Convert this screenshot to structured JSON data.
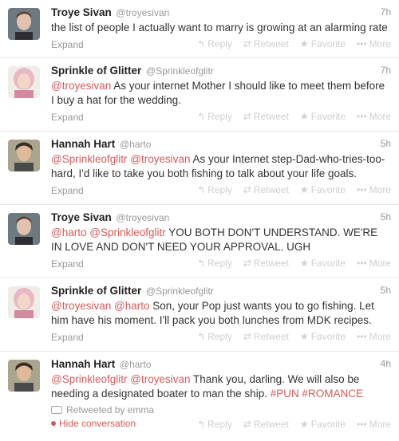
{
  "labels": {
    "expand": "Expand",
    "reply": "Reply",
    "retweet": "Retweet",
    "favorite": "Favorite",
    "more": "More"
  },
  "icons": {
    "reply": "reply-arrow-icon",
    "retweet": "retweet-icon",
    "favorite": "star-icon",
    "more": "ellipsis-icon"
  },
  "colors": {
    "link": "#d35c5c",
    "muted": "#999999",
    "action": "#cfcfcf"
  },
  "tweets": [
    {
      "fullname": "Troye Sivan",
      "username": "@troyesivan",
      "time": "7h",
      "text": "the list of people I actually want to marry is growing at an alarming rate"
    },
    {
      "fullname": "Sprinkle of Glitter",
      "username": "@Sprinkleofglitr",
      "time": "7h",
      "mention1": "@troyesivan",
      "text": " As your internet Mother I should like to meet them before I buy a hat for the wedding."
    },
    {
      "fullname": "Hannah Hart",
      "username": "@harto",
      "time": "5h",
      "mention1": "@Sprinkleofglitr",
      "mention2": "@troyesivan",
      "text": " As your Internet step-Dad-who-tries-too-hard, I'd like to take you both fishing to talk about your life goals."
    },
    {
      "fullname": "Troye Sivan",
      "username": "@troyesivan",
      "time": "5h",
      "mention1": "@harto",
      "mention2": "@Sprinkleofglitr",
      "text": " YOU BOTH DON'T UNDERSTAND. WE'RE IN LOVE AND DON'T NEED YOUR APPROVAL. UGH"
    },
    {
      "fullname": "Sprinkle of Glitter",
      "username": "@Sprinkleofglitr",
      "time": "5h",
      "mention1": "@troyesivan",
      "mention2": "@harto",
      "text": " Son, your Pop just wants you to go fishing. Let him have his moment. I'll pack you both lunches from MDK recipes."
    },
    {
      "fullname": "Hannah Hart",
      "username": "@harto",
      "time": "4h",
      "mention1": "@Sprinkleofglitr",
      "mention2": "@troyesivan",
      "text": " Thank you, darling. We will also be needing a designated boater to man the ship. ",
      "hashtag1": "#PUN",
      "hashtag2": "#ROMANCE",
      "retweeted_by": "Retweeted by emma",
      "hide_conversation": "Hide conversation"
    }
  ]
}
